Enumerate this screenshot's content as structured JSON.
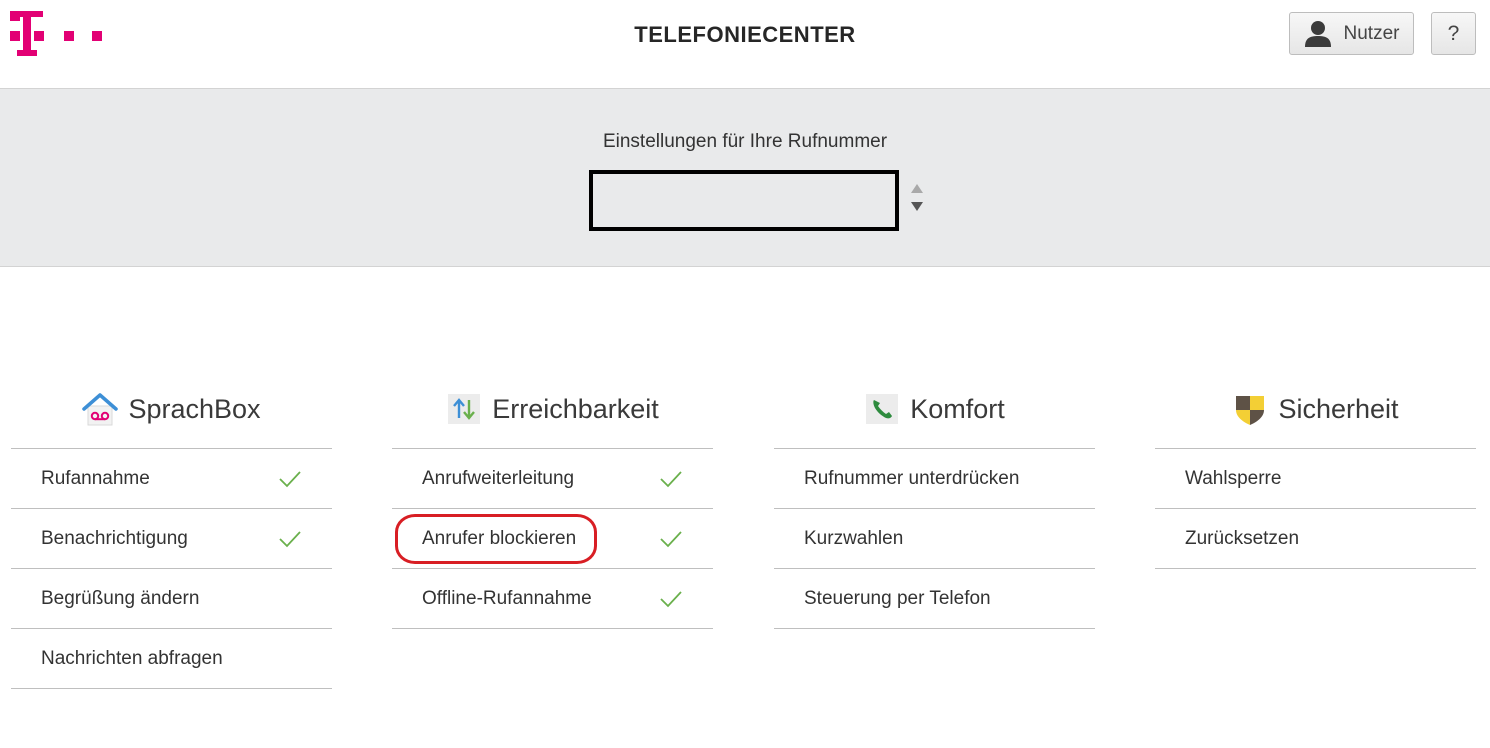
{
  "header": {
    "title": "TELEFONIECENTER",
    "user_label": "Nutzer",
    "help_label": "?",
    "brand_color": "#e20074"
  },
  "banner": {
    "label": "Einstellungen für Ihre Rufnummer",
    "number_value": ""
  },
  "columns": [
    {
      "title": "SprachBox",
      "icon": "voicemail-house-icon",
      "items": [
        {
          "label": "Rufannahme",
          "active": true
        },
        {
          "label": "Benachrichtigung",
          "active": true
        },
        {
          "label": "Begrüßung ändern",
          "active": false
        },
        {
          "label": "Nachrichten abfragen",
          "active": false
        }
      ]
    },
    {
      "title": "Erreichbarkeit",
      "icon": "forwarding-arrows-icon",
      "items": [
        {
          "label": "Anrufweiterleitung",
          "active": true
        },
        {
          "label": "Anrufer blockieren",
          "active": true
        },
        {
          "label": "Offline-Rufannahme",
          "active": true
        }
      ]
    },
    {
      "title": "Komfort",
      "icon": "phone-handset-icon",
      "items": [
        {
          "label": "Rufnummer unterdrücken",
          "active": false
        },
        {
          "label": "Kurzwahlen",
          "active": false
        },
        {
          "label": "Steuerung per Telefon",
          "active": false
        }
      ]
    },
    {
      "title": "Sicherheit",
      "icon": "shield-icon",
      "items": [
        {
          "label": "Wahlsperre",
          "active": false
        },
        {
          "label": "Zurücksetzen",
          "active": false
        }
      ]
    }
  ],
  "colors": {
    "check": "#6ab04c",
    "highlight": "#d81e24"
  }
}
